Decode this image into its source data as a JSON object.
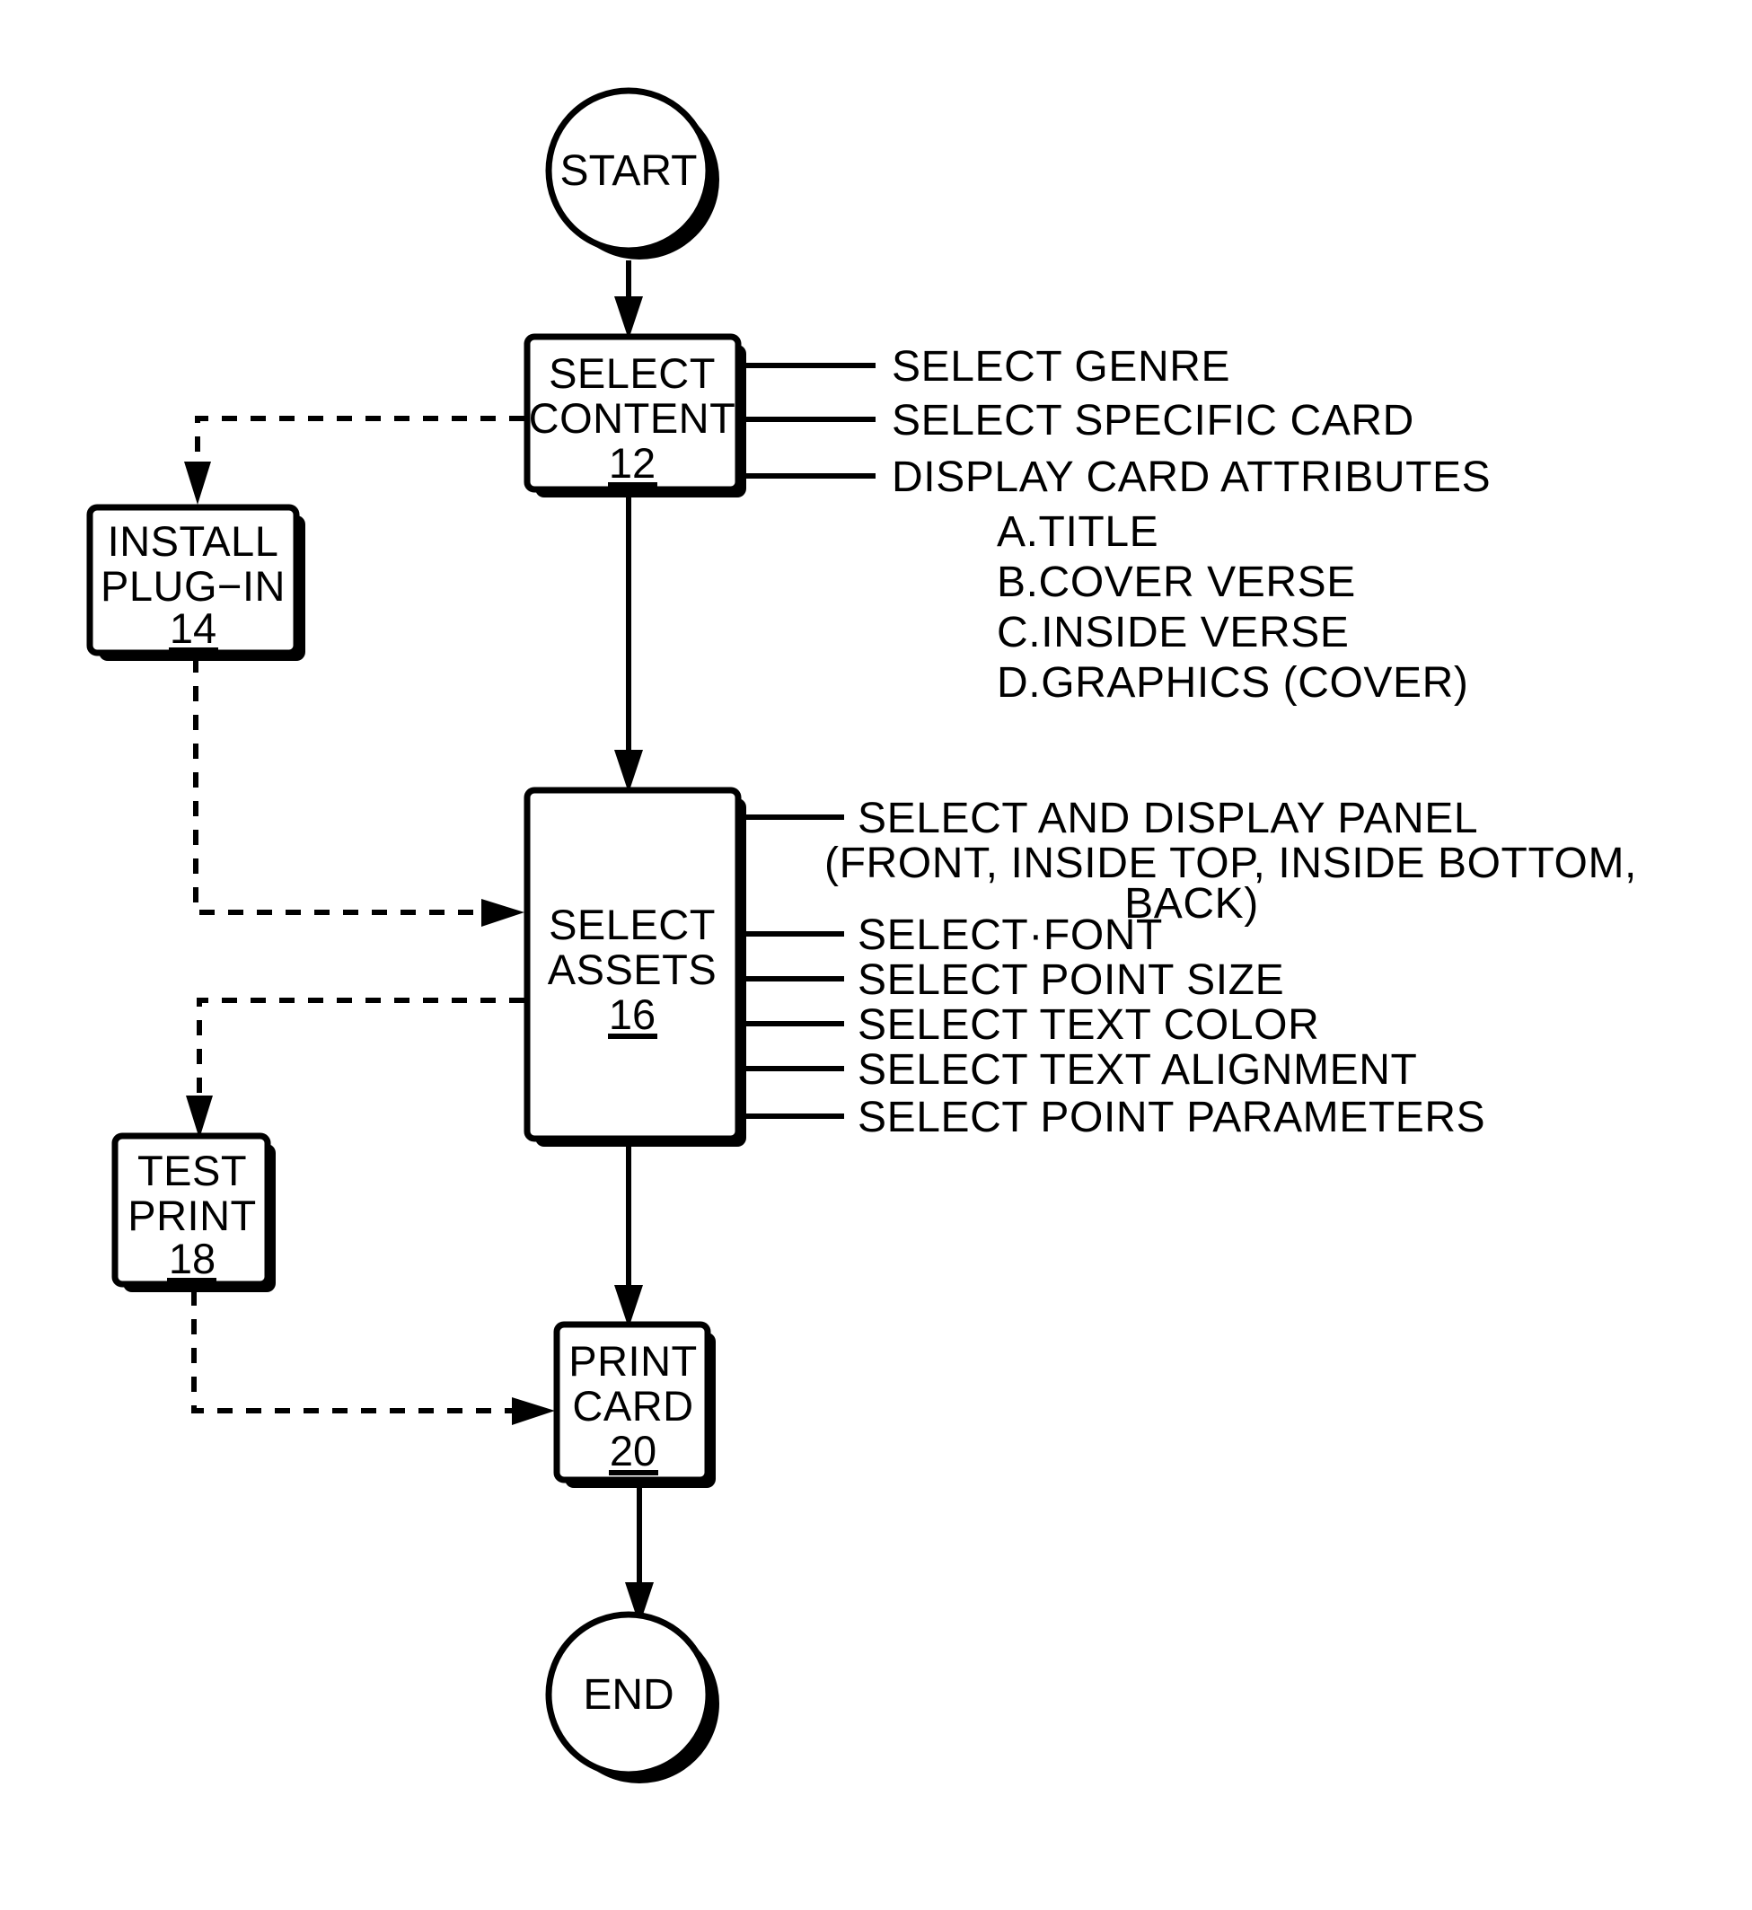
{
  "diagram": {
    "title": "Greeting Card Creation Process Flowchart",
    "background_color": "#ffffff",
    "line_color": "#000000",
    "nodes": {
      "start": {
        "label": "START",
        "shape": "circle"
      },
      "select_content": {
        "line1": "SELECT",
        "line2": "CONTENT",
        "ref": "12",
        "shape": "rectangle"
      },
      "install_plugin": {
        "line1": "INSTALL",
        "line2": "PLUG−IN",
        "ref": "14",
        "shape": "rectangle"
      },
      "select_assets": {
        "line1": "SELECT",
        "line2": "ASSETS",
        "ref": "16",
        "shape": "rectangle"
      },
      "test_print": {
        "line1": "TEST",
        "line2": "PRINT",
        "ref": "18",
        "shape": "rectangle"
      },
      "print_card": {
        "line1": "PRINT",
        "line2": "CARD",
        "ref": "20",
        "shape": "rectangle"
      },
      "end": {
        "label": "END",
        "shape": "circle"
      }
    },
    "content_annotations": {
      "items": [
        "SELECT  GENRE",
        "SELECT  SPECIFIC  CARD",
        "DISPLAY  CARD  ATTRIBUTES"
      ],
      "sublist": [
        "A.TITLE",
        "B.COVER  VERSE",
        "C.INSIDE  VERSE",
        "D.GRAPHICS  (COVER)"
      ]
    },
    "assets_annotations": {
      "panel_line1": "SELECT  AND  DISPLAY  PANEL",
      "panel_line2": "(FRONT,  INSIDE  TOP,  INSIDE  BOTTOM,",
      "panel_line3": "BACK)",
      "items": [
        "SELECT·FONT",
        "SELECT  POINT  SIZE",
        "SELECT  TEXT  COLOR",
        "SELECT  TEXT  ALIGNMENT",
        "SELECT  POINT  PARAMETERS"
      ]
    }
  }
}
